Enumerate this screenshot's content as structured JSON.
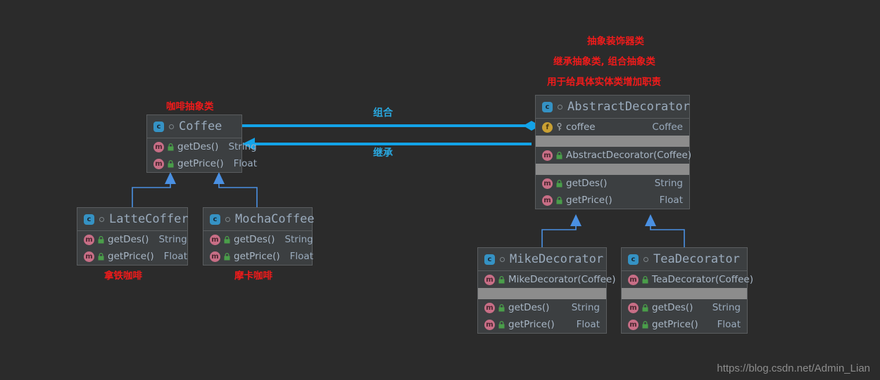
{
  "diagram": {
    "background": "#2b2b2b",
    "accent_blue": "#2196f3",
    "annotation_red": "#ef1b1b",
    "edge_label_blue": "#29a8e0"
  },
  "notes": {
    "coffee_abstract": "咖啡抽象类",
    "latte": "拿铁咖啡",
    "mocha": "摩卡咖啡",
    "decorator_line1": "抽象装饰器类",
    "decorator_line2": "继承抽象类, 组合抽象类",
    "decorator_line3": "用于给具体实体类增加职责"
  },
  "edges": {
    "composition_label": "组合",
    "inheritance_label": "继承"
  },
  "icons": {
    "class": "c",
    "method": "m",
    "field": "f",
    "abstract_marker": "abstract-dot-icon",
    "lock": "lock-icon",
    "key": "key-icon"
  },
  "classes": {
    "coffee": {
      "name": "Coffee",
      "members": [
        {
          "kind": "method",
          "vis": "lock",
          "name": "getDes()",
          "type": "String"
        },
        {
          "kind": "method",
          "vis": "lock",
          "name": "getPrice()",
          "type": "Float"
        }
      ]
    },
    "latte": {
      "name": "LatteCoffer",
      "members": [
        {
          "kind": "method",
          "vis": "lock",
          "name": "getDes()",
          "type": "String"
        },
        {
          "kind": "method",
          "vis": "lock",
          "name": "getPrice()",
          "type": "Float"
        }
      ]
    },
    "mocha": {
      "name": "MochaCoffee",
      "members": [
        {
          "kind": "method",
          "vis": "lock",
          "name": "getDes()",
          "type": "String"
        },
        {
          "kind": "method",
          "vis": "lock",
          "name": "getPrice()",
          "type": "Float"
        }
      ]
    },
    "abstract_decorator": {
      "name": "AbstractDecorator",
      "field": {
        "kind": "field",
        "vis": "key",
        "name": "coffee",
        "type": "Coffee"
      },
      "constructor": {
        "kind": "method",
        "vis": "lock",
        "name": "AbstractDecorator(Coffee)",
        "type": ""
      },
      "members": [
        {
          "kind": "method",
          "vis": "lock",
          "name": "getDes()",
          "type": "String"
        },
        {
          "kind": "method",
          "vis": "lock",
          "name": "getPrice()",
          "type": "Float"
        }
      ]
    },
    "mike_decorator": {
      "name": "MikeDecorator",
      "constructor": {
        "kind": "method",
        "vis": "lock",
        "name": "MikeDecorator(Coffee)",
        "type": ""
      },
      "members": [
        {
          "kind": "method",
          "vis": "lock",
          "name": "getDes()",
          "type": "String"
        },
        {
          "kind": "method",
          "vis": "lock",
          "name": "getPrice()",
          "type": "Float"
        }
      ]
    },
    "tea_decorator": {
      "name": "TeaDecorator",
      "constructor": {
        "kind": "method",
        "vis": "lock",
        "name": "TeaDecorator(Coffee)",
        "type": ""
      },
      "members": [
        {
          "kind": "method",
          "vis": "lock",
          "name": "getDes()",
          "type": "String"
        },
        {
          "kind": "method",
          "vis": "lock",
          "name": "getPrice()",
          "type": "Float"
        }
      ]
    }
  },
  "watermark": "https://blog.csdn.net/Admin_Lian"
}
